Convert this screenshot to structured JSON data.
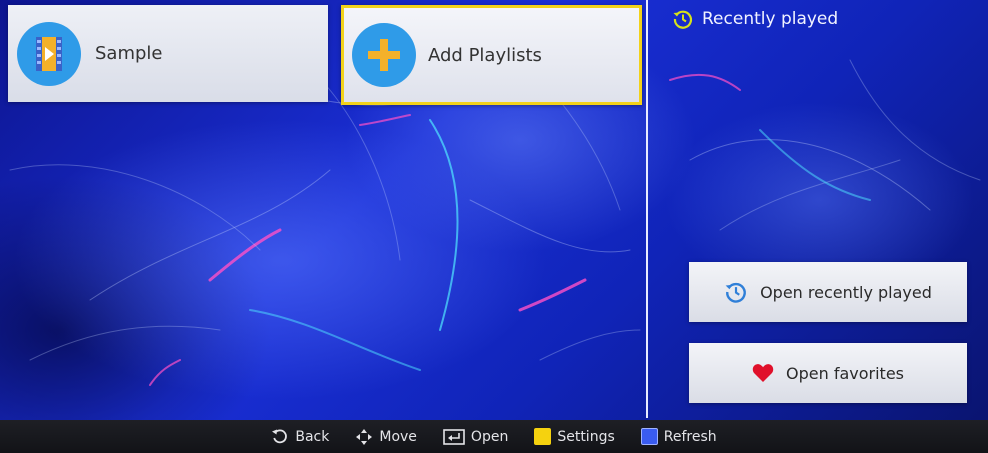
{
  "tiles": [
    {
      "label": "Sample",
      "icon": "video-file-icon"
    },
    {
      "label": "Add Playlists",
      "icon": "plus-icon"
    }
  ],
  "recently_played": {
    "title": "Recently played",
    "icon": "history-icon",
    "buttons": [
      {
        "label": "Open recently played",
        "icon": "history-icon"
      },
      {
        "label": "Open favorites",
        "icon": "heart-icon"
      }
    ]
  },
  "footer": {
    "back": "Back",
    "move": "Move",
    "open": "Open",
    "settings": "Settings",
    "refresh": "Refresh"
  },
  "colors": {
    "focus_border": "#f2d21a",
    "icon_circle": "#2f9be8",
    "settings_key": "#f5d20f",
    "refresh_key": "#3a5cf0",
    "heart": "#e0102a",
    "history_accent": "#d6e21a"
  }
}
